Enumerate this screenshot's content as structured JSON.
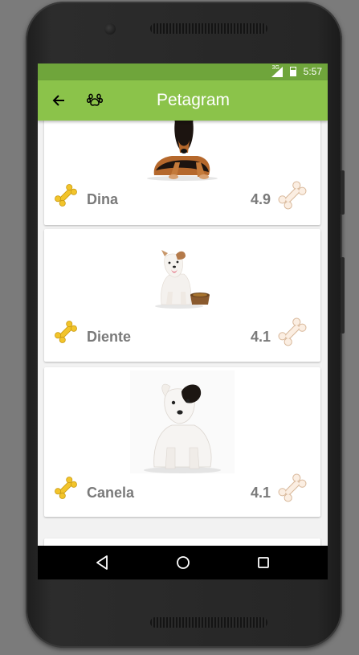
{
  "status_bar": {
    "time": "5:57",
    "network": "3G"
  },
  "app_bar": {
    "title": "Petagram",
    "back_icon": "arrow-back-icon",
    "paw_icon": "paw-icon",
    "color": "#8bc34a"
  },
  "pets": [
    {
      "name": "Dina",
      "rating": "4.9"
    },
    {
      "name": "Diente",
      "rating": "4.1"
    },
    {
      "name": "Canela",
      "rating": "4.1"
    }
  ],
  "nav_bar": {
    "back_icon": "triangle-back-icon",
    "home_icon": "circle-home-icon",
    "recents_icon": "square-recents-icon"
  }
}
